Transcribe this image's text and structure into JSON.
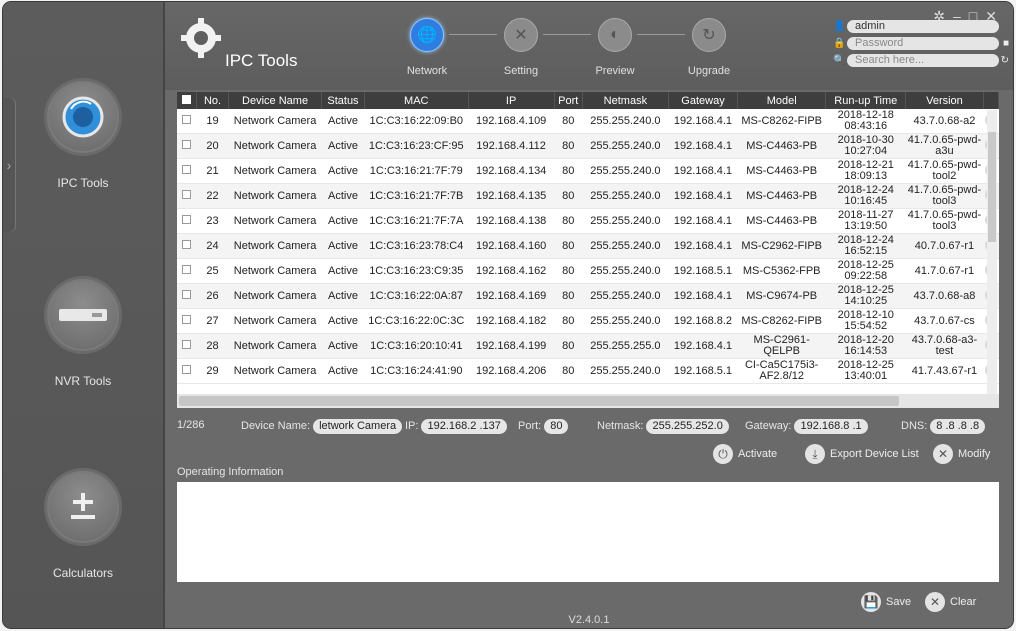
{
  "sidebar": {
    "tools": [
      {
        "label": "IPC Tools",
        "icon": "camera-lens-icon"
      },
      {
        "label": "NVR Tools",
        "icon": "nvr-device-icon"
      },
      {
        "label": "Calculators",
        "icon": "plus-minus-icon"
      }
    ]
  },
  "header": {
    "app_title": "IPC Tools",
    "steps": [
      {
        "label": "Network",
        "active": true
      },
      {
        "label": "Setting",
        "active": false
      },
      {
        "label": "Preview",
        "active": false
      },
      {
        "label": "Upgrade",
        "active": false
      }
    ],
    "username": "admin",
    "password_placeholder": "Password",
    "search_placeholder": "Search here..."
  },
  "table": {
    "columns": [
      "",
      "No.",
      "Device Name",
      "Status",
      "MAC",
      "IP",
      "Port",
      "Netmask",
      "Gateway",
      "Model",
      "Run-up Time",
      "Version",
      ""
    ],
    "rows": [
      [
        "19",
        "Network Camera",
        "Active",
        "1C:C3:16:22:09:B0",
        "192.168.4.109",
        "80",
        "255.255.240.0",
        "192.168.4.1",
        "MS-C8262-FIPB",
        "2018-12-18 08:43:16",
        "43.7.0.68-a2"
      ],
      [
        "20",
        "Network Camera",
        "Active",
        "1C:C3:16:23:CF:95",
        "192.168.4.112",
        "80",
        "255.255.240.0",
        "192.168.4.1",
        "MS-C4463-PB",
        "2018-10-30 10:27:04",
        "41.7.0.65-pwd-a3u"
      ],
      [
        "21",
        "Network Camera",
        "Active",
        "1C:C3:16:21:7F:79",
        "192.168.4.134",
        "80",
        "255.255.240.0",
        "192.168.4.1",
        "MS-C4463-PB",
        "2018-12-21 18:09:13",
        "41.7.0.65-pwd-tool2"
      ],
      [
        "22",
        "Network Camera",
        "Active",
        "1C:C3:16:21:7F:7B",
        "192.168.4.135",
        "80",
        "255.255.240.0",
        "192.168.4.1",
        "MS-C4463-PB",
        "2018-12-24 10:16:45",
        "41.7.0.65-pwd-tool3"
      ],
      [
        "23",
        "Network Camera",
        "Active",
        "1C:C3:16:21:7F:7A",
        "192.168.4.138",
        "80",
        "255.255.240.0",
        "192.168.4.1",
        "MS-C4463-PB",
        "2018-11-27 13:19:50",
        "41.7.0.65-pwd-tool3"
      ],
      [
        "24",
        "Network Camera",
        "Active",
        "1C:C3:16:23:78:C4",
        "192.168.4.160",
        "80",
        "255.255.240.0",
        "192.168.4.1",
        "MS-C2962-FIPB",
        "2018-12-24 16:52:15",
        "40.7.0.67-r1"
      ],
      [
        "25",
        "Network Camera",
        "Active",
        "1C:C3:16:23:C9:35",
        "192.168.4.162",
        "80",
        "255.255.240.0",
        "192.168.5.1",
        "MS-C5362-FPB",
        "2018-12-25 09:22:58",
        "41.7.0.67-r1"
      ],
      [
        "26",
        "Network Camera",
        "Active",
        "1C:C3:16:22:0A:87",
        "192.168.4.169",
        "80",
        "255.255.240.0",
        "192.168.4.1",
        "MS-C9674-PB",
        "2018-12-25 14:10:25",
        "43.7.0.68-a8"
      ],
      [
        "27",
        "Network Camera",
        "Active",
        "1C:C3:16:22:0C:3C",
        "192.168.4.182",
        "80",
        "255.255.240.0",
        "192.168.8.2",
        "MS-C8262-FIPB",
        "2018-12-10 15:54:52",
        "43.7.0.67-cs"
      ],
      [
        "28",
        "Network Camera",
        "Active",
        "1C:C3:16:20:10:41",
        "192.168.4.199",
        "80",
        "255.255.255.0",
        "192.168.4.1",
        "MS-C2961-QELPB",
        "2018-12-20 16:14:53",
        "43.7.0.68-a3-test"
      ],
      [
        "29",
        "Network Camera",
        "Active",
        "1C:C3:16:24:41:90",
        "192.168.4.206",
        "80",
        "255.255.240.0",
        "192.168.5.1",
        "CI-Ca5C175i3-AF2.8/12",
        "2018-12-25 13:40:01",
        "41.7.43.67-r1"
      ]
    ]
  },
  "details": {
    "count": "1/286",
    "device_name_label": "Device Name:",
    "device_name": "letwork Camera",
    "ip_label": "IP:",
    "ip": "192.168.2 .137",
    "port_label": "Port:",
    "port": "80",
    "netmask_label": "Netmask:",
    "netmask": "255.255.252.0",
    "gateway_label": "Gateway:",
    "gateway": "192.168.8 .1",
    "dns_label": "DNS:",
    "dns": "8 .8 .8 .8"
  },
  "actions": {
    "activate": "Activate",
    "export": "Export Device List",
    "modify": "Modify"
  },
  "operating_info_label": "Operating Information",
  "bottom": {
    "save": "Save",
    "clear": "Clear"
  },
  "version": "V2.4.0.1"
}
